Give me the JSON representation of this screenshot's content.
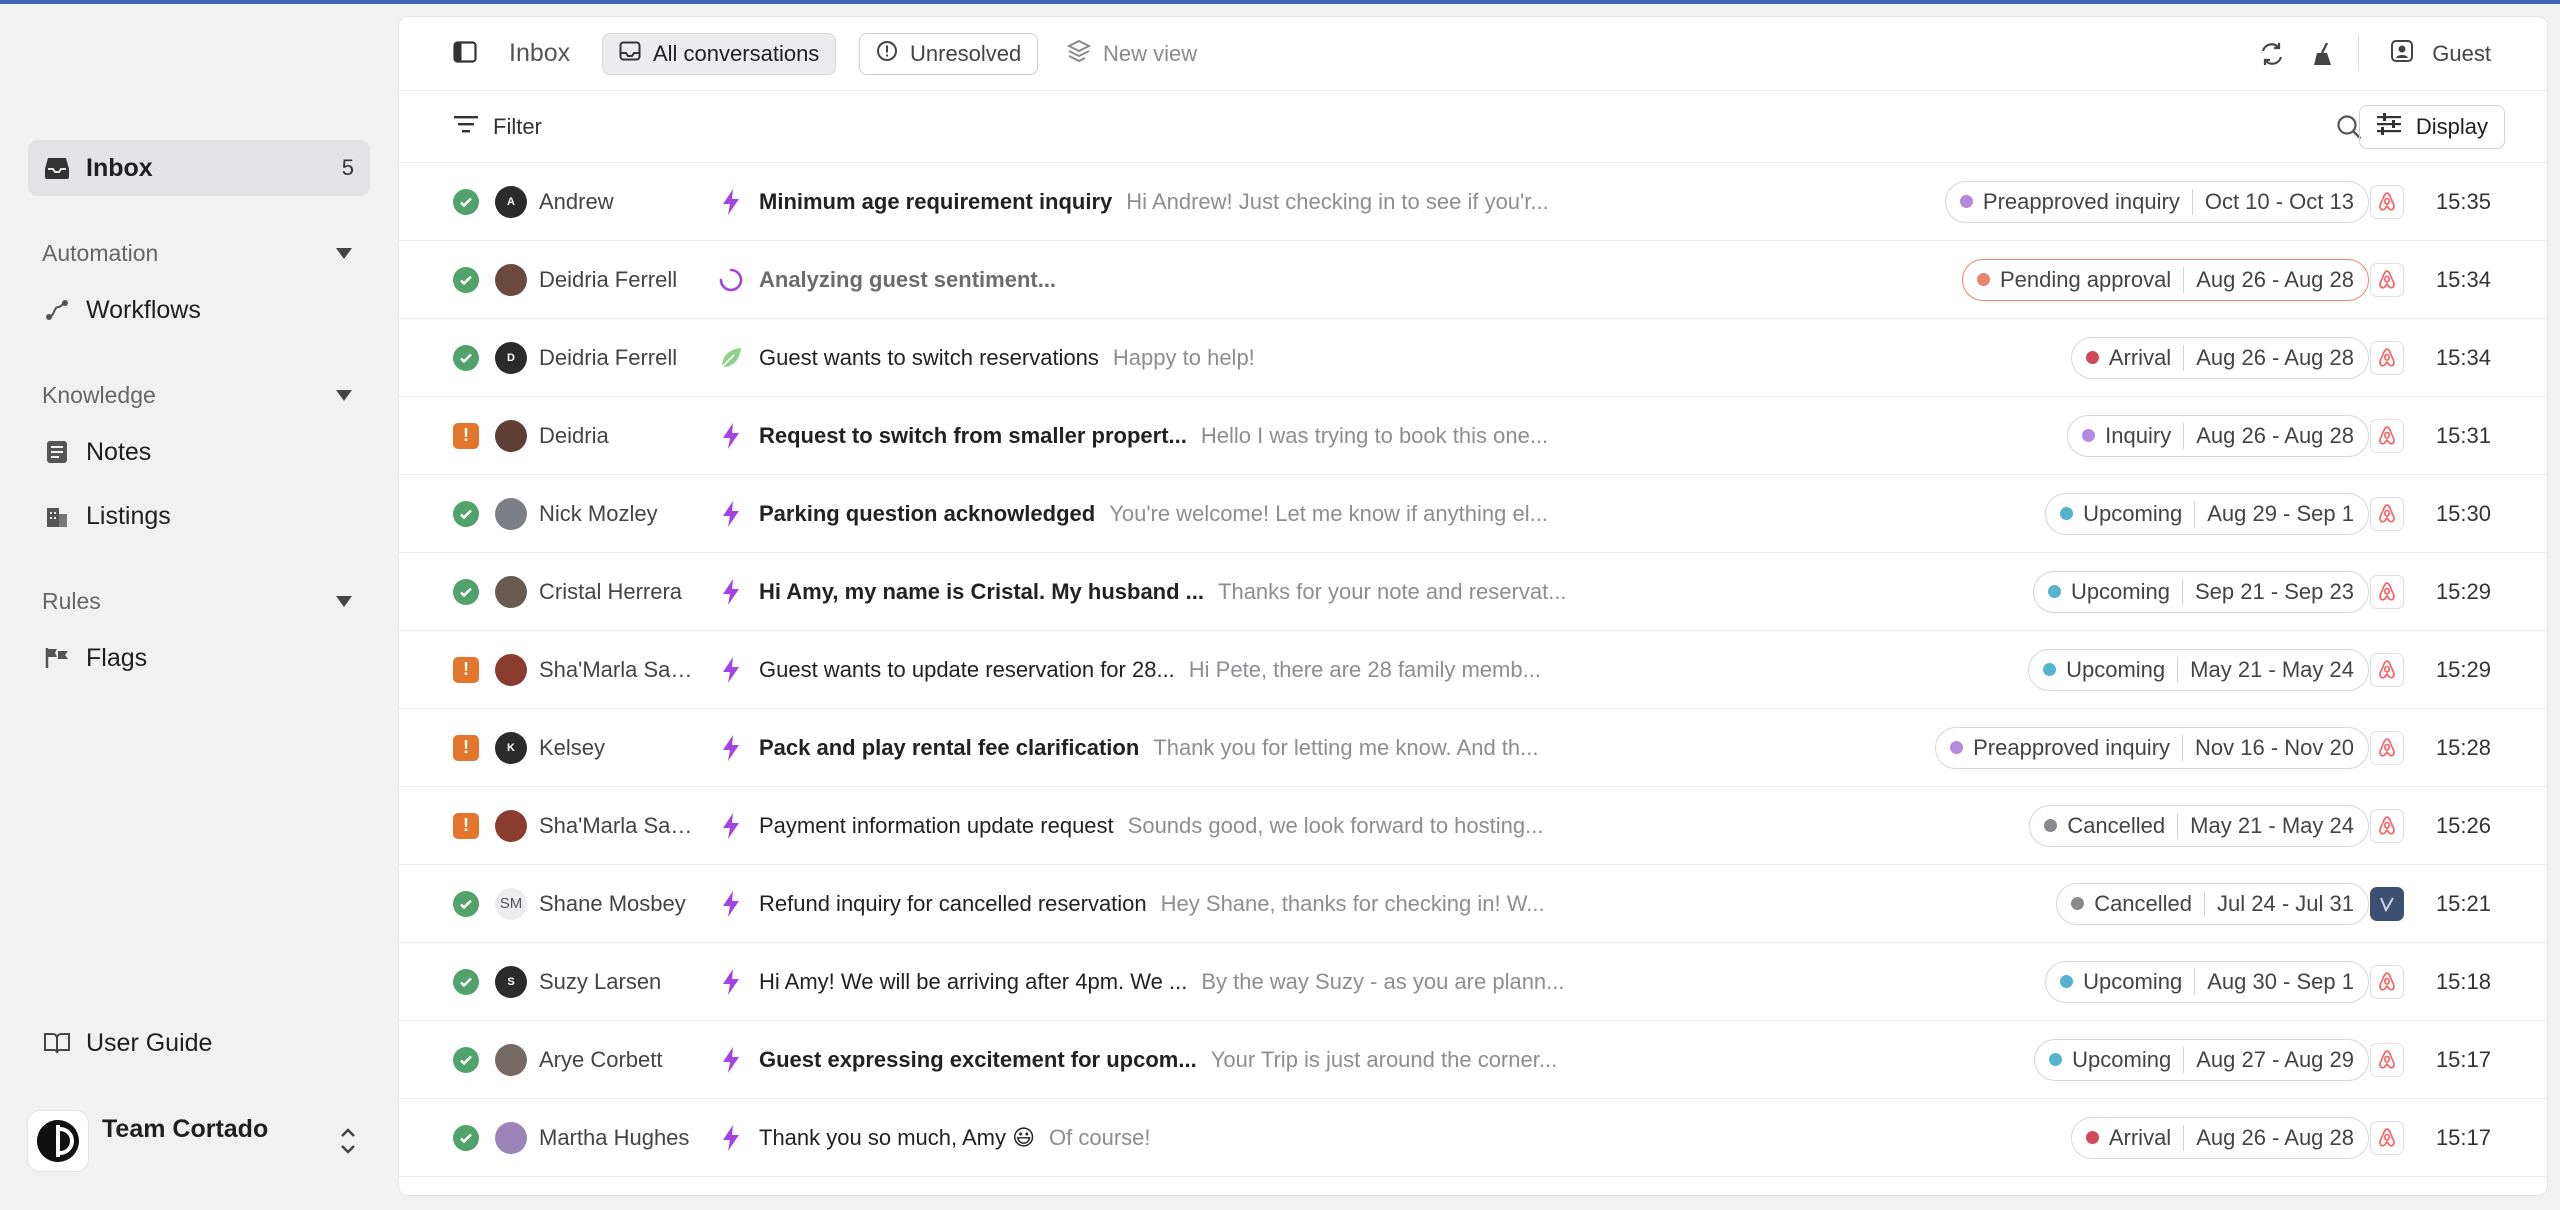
{
  "sidebar": {
    "inbox_label": "Inbox",
    "inbox_count": "5",
    "sections": {
      "automation": "Automation",
      "knowledge": "Knowledge",
      "rules": "Rules"
    },
    "items": {
      "workflows": "Workflows",
      "notes": "Notes",
      "listings": "Listings",
      "flags": "Flags"
    },
    "user_guide": "User Guide",
    "team_name": "Team Cortado"
  },
  "topbar": {
    "title": "Inbox",
    "tabs": [
      "All conversations",
      "Unresolved",
      "New view"
    ],
    "user": "Guest"
  },
  "filterbar": {
    "filter_label": "Filter",
    "display_label": "Display"
  },
  "colors": {
    "success": "#52a36b",
    "warning": "#e4752c",
    "bolt": "#a343e6",
    "airbnb": "#ff5a5f"
  },
  "conversations": [
    {
      "status": "ok",
      "avatar": "A",
      "avatar_color": "#2b2b2b",
      "name": "Andrew",
      "icon": "bolt-icon",
      "subject": "Minimum age requirement inquiry",
      "subject_style": "bold",
      "preview": "Hi Andrew! Just checking in to see if you'r...",
      "tag": "Preapproved inquiry",
      "tag_color": "#b58be0",
      "dates": "Oct 10 - Oct 13",
      "channel": "airbnb",
      "time": "15:35"
    },
    {
      "status": "ok",
      "avatar": "",
      "avatar_color": "#6b4a3e",
      "name": "Deidria Ferrell",
      "icon": "spinner-icon",
      "subject": "Analyzing guest sentiment...",
      "subject_style": "muted",
      "preview": "",
      "tag": "Pending approval",
      "tag_color": "#e3886f",
      "dates": "Aug 26 - Aug 28",
      "channel": "airbnb",
      "time": "15:34"
    },
    {
      "status": "ok",
      "avatar": "D",
      "avatar_color": "#2b2b2b",
      "name": "Deidria Ferrell",
      "icon": "leaf-icon",
      "subject": "Guest wants to switch reservations",
      "subject_style": "normal",
      "preview": "Happy to help!",
      "tag": "Arrival",
      "tag_color": "#d04a5a",
      "dates": "Aug 26 - Aug 28",
      "channel": "airbnb",
      "time": "15:34"
    },
    {
      "status": "warn",
      "avatar": "",
      "avatar_color": "#5e3f35",
      "name": "Deidria",
      "icon": "bolt-icon",
      "subject": "Request to switch from smaller propert...",
      "subject_style": "bold",
      "preview": "Hello I was trying to book this one...",
      "tag": "Inquiry",
      "tag_color": "#b58be0",
      "dates": "Aug 26 - Aug 28",
      "channel": "airbnb",
      "time": "15:31"
    },
    {
      "status": "ok",
      "avatar": "",
      "avatar_color": "#7d7f86",
      "name": "Nick Mozley",
      "icon": "bolt-icon",
      "subject": "Parking question acknowledged",
      "subject_style": "bold",
      "preview": "You're welcome! Let me know if anything el...",
      "tag": "Upcoming",
      "tag_color": "#56b3cf",
      "dates": "Aug 29 - Sep 1",
      "channel": "airbnb",
      "time": "15:30"
    },
    {
      "status": "ok",
      "avatar": "",
      "avatar_color": "#6a5a4f",
      "name": "Cristal Herrera",
      "icon": "bolt-icon",
      "subject": "Hi Amy, my name is Cristal. My husband ...",
      "subject_style": "bold",
      "preview": "Thanks for your note and reservat...",
      "tag": "Upcoming",
      "tag_color": "#56b3cf",
      "dates": "Sep 21 - Sep 23",
      "channel": "airbnb",
      "time": "15:29"
    },
    {
      "status": "warn",
      "avatar": "",
      "avatar_color": "#8a3d2f",
      "name": "Sha'Marla Sam...",
      "icon": "bolt-icon",
      "subject": "Guest wants to update reservation for 28...",
      "subject_style": "normal",
      "preview": "Hi Pete, there are 28 family memb...",
      "tag": "Upcoming",
      "tag_color": "#56b3cf",
      "dates": "May 21 - May 24",
      "channel": "airbnb",
      "time": "15:29"
    },
    {
      "status": "warn",
      "avatar": "K",
      "avatar_color": "#2b2b2b",
      "name": "Kelsey",
      "icon": "bolt-icon",
      "subject": "Pack and play rental fee clarification",
      "subject_style": "bold",
      "preview": "Thank you for letting me know. And th...",
      "tag": "Preapproved inquiry",
      "tag_color": "#b58be0",
      "dates": "Nov 16 - Nov 20",
      "channel": "airbnb",
      "time": "15:28"
    },
    {
      "status": "warn",
      "avatar": "",
      "avatar_color": "#8a3d2f",
      "name": "Sha'Marla Sam...",
      "icon": "bolt-icon",
      "subject": "Payment information update request",
      "subject_style": "normal",
      "preview": "Sounds good, we look forward to hosting...",
      "tag": "Cancelled",
      "tag_color": "#8a8a8e",
      "dates": "May 21 - May 24",
      "channel": "airbnb",
      "time": "15:26"
    },
    {
      "status": "ok",
      "avatar": "SM",
      "avatar_color": "#ececee",
      "name": "Shane Mosbey",
      "icon": "bolt-icon",
      "subject": "Refund inquiry for cancelled reservation",
      "subject_style": "normal",
      "preview": "Hey Shane, thanks for checking in! W...",
      "tag": "Cancelled",
      "tag_color": "#8a8a8e",
      "dates": "Jul 24 - Jul 31",
      "channel": "vrbo",
      "time": "15:21"
    },
    {
      "status": "ok",
      "avatar": "S",
      "avatar_color": "#2b2b2b",
      "name": "Suzy Larsen",
      "icon": "bolt-icon",
      "subject": "Hi Amy! We will be arriving after 4pm. We ...",
      "subject_style": "normal",
      "preview": "By the way Suzy - as you are plann...",
      "tag": "Upcoming",
      "tag_color": "#56b3cf",
      "dates": "Aug 30 - Sep 1",
      "channel": "airbnb",
      "time": "15:18"
    },
    {
      "status": "ok",
      "avatar": "",
      "avatar_color": "#746a63",
      "name": "Arye Corbett",
      "icon": "bolt-icon",
      "subject": "Guest expressing excitement for upcom...",
      "subject_style": "bold",
      "preview": "Your Trip is just around the corner...",
      "tag": "Upcoming",
      "tag_color": "#56b3cf",
      "dates": "Aug 27 - Aug 29",
      "channel": "airbnb",
      "time": "15:17"
    },
    {
      "status": "ok",
      "avatar": "",
      "avatar_color": "#9a84b8",
      "name": "Martha Hughes",
      "icon": "bolt-icon",
      "subject": "Thank you so much, Amy 😃",
      "subject_style": "normal",
      "preview": "Of course!",
      "tag": "Arrival",
      "tag_color": "#d04a5a",
      "dates": "Aug 26 - Aug 28",
      "channel": "airbnb",
      "time": "15:17"
    }
  ]
}
